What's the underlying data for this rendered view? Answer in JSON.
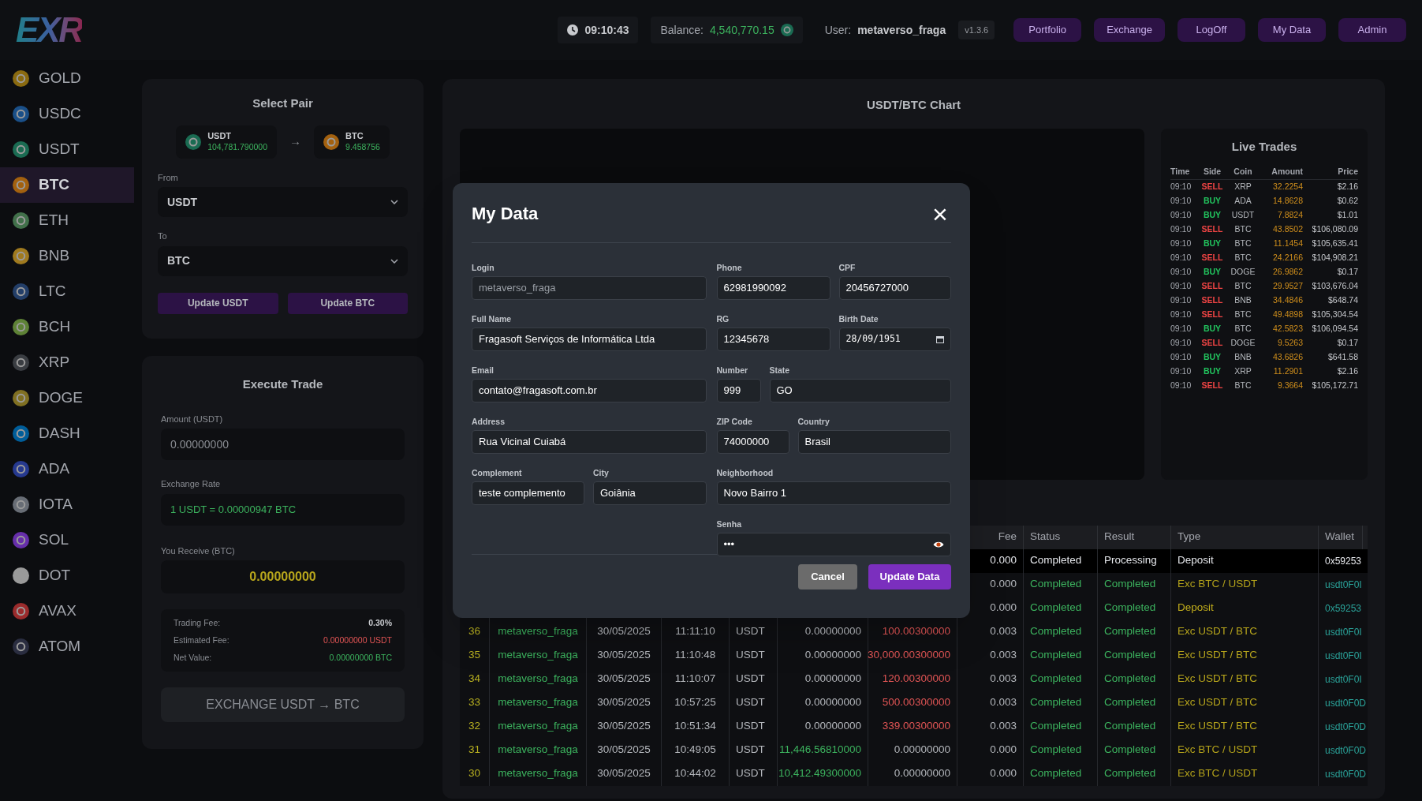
{
  "top_bar": {
    "logo": "EXR",
    "time": "09:10:43",
    "balance_label": "Balance:",
    "balance": "4,540,770.15",
    "user_label": "User:",
    "user": "metaverso_fraga",
    "version": "v1.3.6",
    "nav": [
      "Portfolio",
      "Exchange",
      "LogOff",
      "My Data",
      "Admin"
    ]
  },
  "sidebar": {
    "items": [
      {
        "label": "GOLD",
        "color": "#8a6a10",
        "selected": false
      },
      {
        "label": "USDC",
        "color": "#1a4f88",
        "selected": false
      },
      {
        "label": "USDT",
        "color": "#1a6b52",
        "selected": false
      },
      {
        "label": "BTC",
        "color": "#a3610f",
        "selected": true
      },
      {
        "label": "ETH",
        "color": "#41704a",
        "selected": false
      },
      {
        "label": "BNB",
        "color": "#a07a1f",
        "selected": false
      },
      {
        "label": "LTC",
        "color": "#233e68",
        "selected": false
      },
      {
        "label": "BCH",
        "color": "#5e8236",
        "selected": false
      },
      {
        "label": "XRP",
        "color": "#3a3d42",
        "selected": false
      },
      {
        "label": "DOGE",
        "color": "#807022",
        "selected": false
      },
      {
        "label": "DASH",
        "color": "#005d99",
        "selected": false
      },
      {
        "label": "ADA",
        "color": "#26398f",
        "selected": false
      },
      {
        "label": "IOTA",
        "color": "#686d75",
        "selected": false
      },
      {
        "label": "SOL",
        "color": "#662eaa",
        "selected": false
      },
      {
        "label": "DOT",
        "color": "#9a9a9a",
        "selected": false
      },
      {
        "label": "AVAX",
        "color": "#9a2b2c",
        "selected": false
      },
      {
        "label": "ATOM",
        "color": "#2a2d40",
        "selected": false
      }
    ]
  },
  "select_pair": {
    "title": "Select Pair",
    "from_coin": {
      "symbol": "USDT",
      "balance": "104,781.790000",
      "color": "#1a6b52"
    },
    "arrow": "→",
    "to_coin": {
      "symbol": "BTC",
      "balance": "9.458756",
      "color": "#a3610f"
    },
    "from_label": "From",
    "from_value": "USDT",
    "to_label": "To",
    "to_value": "BTC",
    "buttons": [
      "Update USDT",
      "Update BTC"
    ]
  },
  "execute_trade": {
    "title": "Execute Trade",
    "amount_label": "Amount (USDT)",
    "amount_placeholder": "0.00000000",
    "rate_label": "Exchange Rate",
    "rate": "1 USDT = 0.00000947 BTC",
    "receive_label": "You Receive (BTC)",
    "receive": "0.00000000",
    "fees": [
      {
        "label": "Trading Fee:",
        "value": "0.30%",
        "kind": "neutral"
      },
      {
        "label": "Estimated Fee:",
        "value": "0.00000000 USDT",
        "kind": "cost"
      },
      {
        "label": "Net Value:",
        "value": "0.00000000 BTC",
        "kind": "gain"
      }
    ],
    "button": "EXCHANGE USDT → BTC",
    "button_disabled": true
  },
  "chart": {
    "title": "USDT/BTC Chart"
  },
  "live_trades": {
    "title": "Live Trades",
    "columns": [
      "Time",
      "Side",
      "Coin",
      "Amount",
      "Price"
    ],
    "rows": [
      {
        "time": "09:10",
        "side": "SELL",
        "color": "#ef4444",
        "coin": "XRP",
        "amount": "32.2254",
        "price": "$2.16"
      },
      {
        "time": "09:10",
        "side": "BUY",
        "color": "#22c55e",
        "coin": "ADA",
        "amount": "14.8628",
        "price": "$0.62"
      },
      {
        "time": "09:10",
        "side": "BUY",
        "color": "#22c55e",
        "coin": "USDT",
        "amount": "7.8824",
        "price": "$1.01"
      },
      {
        "time": "09:10",
        "side": "SELL",
        "color": "#ef4444",
        "coin": "BTC",
        "amount": "43.8502",
        "price": "$106,080.09"
      },
      {
        "time": "09:10",
        "side": "BUY",
        "color": "#22c55e",
        "coin": "BTC",
        "amount": "11.1454",
        "price": "$105,635.41"
      },
      {
        "time": "09:10",
        "side": "SELL",
        "color": "#ef4444",
        "coin": "BTC",
        "amount": "24.2166",
        "price": "$104,908.21"
      },
      {
        "time": "09:10",
        "side": "BUY",
        "color": "#22c55e",
        "coin": "DOGE",
        "amount": "26.9862",
        "price": "$0.17"
      },
      {
        "time": "09:10",
        "side": "SELL",
        "color": "#ef4444",
        "coin": "BTC",
        "amount": "29.9527",
        "price": "$103,676.04"
      },
      {
        "time": "09:10",
        "side": "SELL",
        "color": "#ef4444",
        "coin": "BNB",
        "amount": "34.4846",
        "price": "$648.74"
      },
      {
        "time": "09:10",
        "side": "SELL",
        "color": "#ef4444",
        "coin": "BTC",
        "amount": "49.4898",
        "price": "$105,304.54"
      },
      {
        "time": "09:10",
        "side": "BUY",
        "color": "#22c55e",
        "coin": "BTC",
        "amount": "42.5823",
        "price": "$106,094.54"
      },
      {
        "time": "09:10",
        "side": "SELL",
        "color": "#ef4444",
        "coin": "DOGE",
        "amount": "9.5263",
        "price": "$0.17"
      },
      {
        "time": "09:10",
        "side": "BUY",
        "color": "#22c55e",
        "coin": "BNB",
        "amount": "43.6826",
        "price": "$641.58"
      },
      {
        "time": "09:10",
        "side": "BUY",
        "color": "#22c55e",
        "coin": "XRP",
        "amount": "11.2901",
        "price": "$2.16"
      },
      {
        "time": "09:10",
        "side": "SELL",
        "color": "#ef4444",
        "coin": "BTC",
        "amount": "9.3664",
        "price": "$105,172.71"
      }
    ]
  },
  "history_table": {
    "columns": [
      "Fee",
      "Status",
      "Result",
      "Type",
      "Wallet"
    ],
    "rows": [
      {
        "kind": "deposit",
        "selected": true,
        "fee": "0.000",
        "status": "Completed",
        "result": "Processing",
        "type": "Deposit",
        "wallet": "0x59253"
      },
      {
        "kind": "btc_to_usdt",
        "selected": false,
        "fee": "0.000",
        "status": "Completed",
        "result": "Completed",
        "type": "Exc BTC / USDT",
        "wallet": "usdt0F0I"
      },
      {
        "kind": "deposit",
        "selected": false,
        "fee": "0.000",
        "status": "Completed",
        "result": "Completed",
        "type": "Deposit",
        "wallet": "0x59253"
      },
      {
        "kind": "usdt_to_btc",
        "selected": false,
        "id": "36",
        "user": "metaverso_fraga",
        "date": "30/05/2025",
        "time": "11:11:10",
        "coin": "USDT",
        "amount_1": "0.00000000",
        "amount_2": "100.00300000",
        "fee": "0.003",
        "status": "Completed",
        "result": "Completed",
        "type": "Exc USDT / BTC",
        "wallet": "usdt0F0I"
      },
      {
        "kind": "usdt_to_btc",
        "selected": false,
        "id": "35",
        "user": "metaverso_fraga",
        "date": "30/05/2025",
        "time": "11:10:48",
        "coin": "USDT",
        "amount_1": "0.00000000",
        "amount_2": "30,000.00300000",
        "fee": "0.003",
        "status": "Completed",
        "result": "Completed",
        "type": "Exc USDT / BTC",
        "wallet": "usdt0F0I"
      },
      {
        "kind": "usdt_to_btc",
        "selected": false,
        "id": "34",
        "user": "metaverso_fraga",
        "date": "30/05/2025",
        "time": "11:10:07",
        "coin": "USDT",
        "amount_1": "0.00000000",
        "amount_2": "120.00300000",
        "fee": "0.003",
        "status": "Completed",
        "result": "Completed",
        "type": "Exc USDT / BTC",
        "wallet": "usdt0F0I"
      },
      {
        "kind": "usdt_to_btc",
        "selected": false,
        "id": "33",
        "user": "metaverso_fraga",
        "date": "30/05/2025",
        "time": "10:57:25",
        "coin": "USDT",
        "amount_1": "0.00000000",
        "amount_2": "500.00300000",
        "fee": "0.003",
        "status": "Completed",
        "result": "Completed",
        "type": "Exc USDT / BTC",
        "wallet": "usdt0F0D"
      },
      {
        "kind": "usdt_to_btc",
        "selected": false,
        "id": "32",
        "user": "metaverso_fraga",
        "date": "30/05/2025",
        "time": "10:51:34",
        "coin": "USDT",
        "amount_1": "0.00000000",
        "amount_2": "339.00300000",
        "fee": "0.003",
        "status": "Completed",
        "result": "Completed",
        "type": "Exc USDT / BTC",
        "wallet": "usdt0F0D"
      },
      {
        "kind": "btc_to_usdt",
        "selected": false,
        "id": "31",
        "user": "metaverso_fraga",
        "date": "30/05/2025",
        "time": "10:49:05",
        "coin": "USDT",
        "amount_1": "11,446.56810000",
        "amount_2": "0.00000000",
        "fee": "0.000",
        "status": "Completed",
        "result": "Completed",
        "type": "Exc BTC / USDT",
        "wallet": "usdt0F0D"
      },
      {
        "kind": "btc_to_usdt",
        "selected": false,
        "id": "30",
        "user": "metaverso_fraga",
        "date": "30/05/2025",
        "time": "10:44:02",
        "coin": "USDT",
        "amount_1": "10,412.49300000",
        "amount_2": "0.00000000",
        "fee": "0.000",
        "status": "Completed",
        "result": "Completed",
        "type": "Exc BTC / USDT",
        "wallet": "usdt0F0D"
      }
    ]
  },
  "modal": {
    "title": "My Data",
    "close": "×",
    "left_rows": [
      [
        {
          "label": "Login",
          "value": "metaverso_fraga",
          "kind": "readonly"
        }
      ],
      [
        {
          "label": "Full Name",
          "value": "Fragasoft Serviços de Informática Ltda",
          "kind": "text"
        }
      ],
      [
        {
          "label": "Email",
          "value": "contato@fragasoft.com.br",
          "kind": "text"
        }
      ],
      [
        {
          "label": "Address",
          "value": "Rua Vicinal Cuiabá",
          "kind": "text"
        }
      ],
      [
        {
          "label": "Complement",
          "value": "teste complemento",
          "kind": "text"
        },
        {
          "label": "City",
          "value": "Goiânia",
          "kind": "text"
        }
      ]
    ],
    "right_rows": [
      [
        {
          "label": "Phone",
          "value": "62981990092",
          "kind": "text"
        },
        {
          "label": "CPF",
          "value": "20456727000",
          "kind": "text"
        }
      ],
      [
        {
          "label": "RG",
          "value": "12345678",
          "kind": "text"
        },
        {
          "label": "Birth Date",
          "value": "28/09/1951",
          "kind": "date"
        }
      ],
      [
        {
          "label": "Number",
          "value": "999",
          "kind": "text"
        },
        {
          "label": "State",
          "value": "GO",
          "kind": "text"
        }
      ],
      [
        {
          "label": "ZIP Code",
          "value": "74000000",
          "kind": "text"
        },
        {
          "label": "Country",
          "value": "Brasil",
          "kind": "text"
        }
      ],
      [
        {
          "label": "Neighborhood",
          "value": "Novo Bairro 1",
          "kind": "text"
        }
      ],
      [
        {
          "label": "Senha",
          "value": "•••",
          "kind": "password"
        }
      ]
    ],
    "buttons": [
      {
        "label": "Cancel",
        "kind": "secondary"
      },
      {
        "label": "Update Data",
        "kind": "primary"
      }
    ]
  }
}
